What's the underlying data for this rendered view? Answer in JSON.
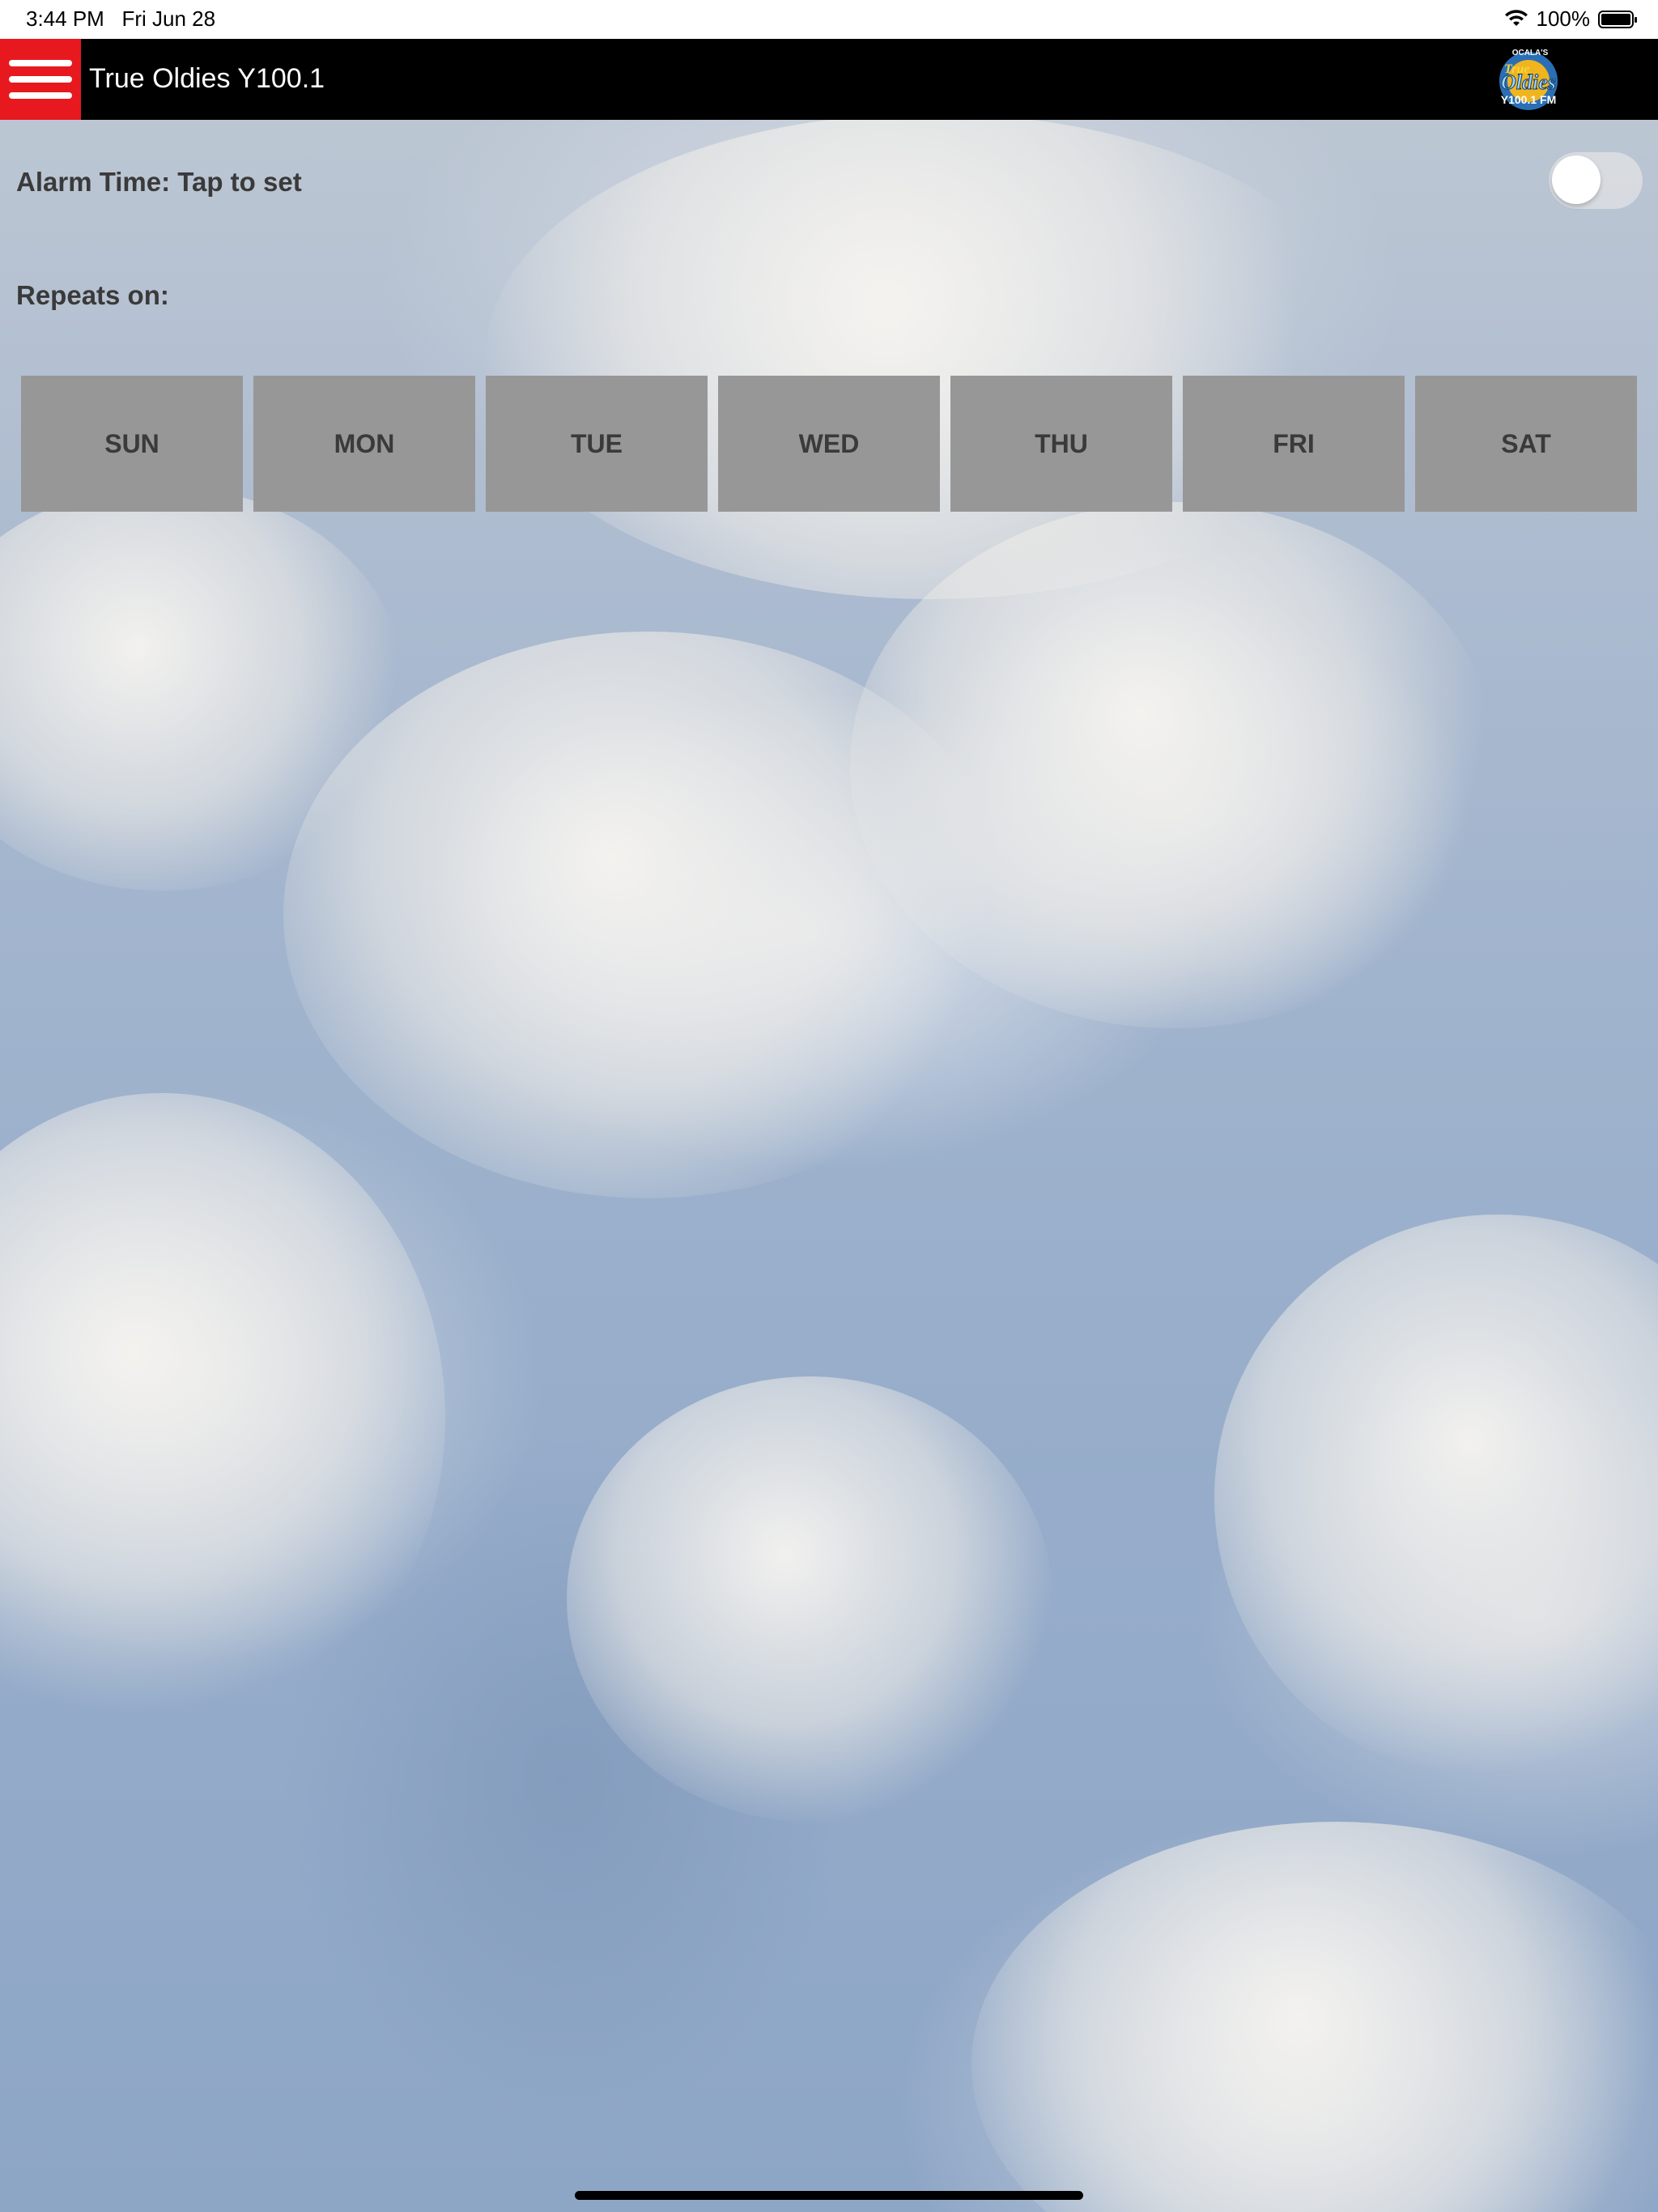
{
  "status_bar": {
    "time": "3:44 PM",
    "date": "Fri Jun 28",
    "battery": "100%",
    "wifi_icon": "wifi-icon",
    "battery_icon": "battery-icon"
  },
  "navbar": {
    "title": "True Oldies Y100.1",
    "menu_icon": "hamburger-menu-icon",
    "brand_color": "#e8181f",
    "logo": {
      "top_text": "OCALA'S",
      "line1": "True",
      "line2": "Oldies",
      "line3": "Y100.1 FM"
    }
  },
  "alarm": {
    "label": "Alarm Time: Tap to set",
    "enabled": false
  },
  "repeats": {
    "label": "Repeats on:",
    "days": [
      "SUN",
      "MON",
      "TUE",
      "WED",
      "THU",
      "FRI",
      "SAT"
    ]
  }
}
